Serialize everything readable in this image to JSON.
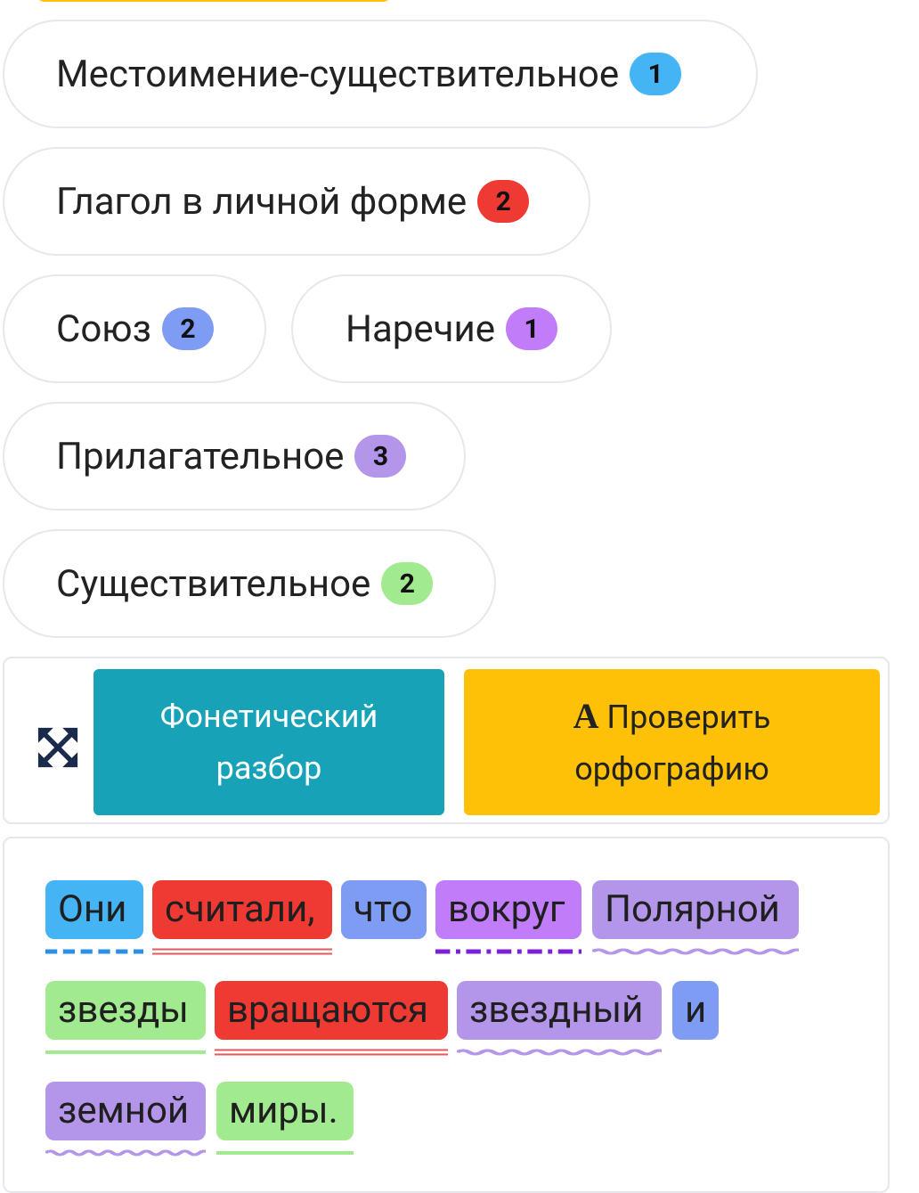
{
  "colors": {
    "pronoun": "#45b4f4",
    "verb": "#ef3a33",
    "conjunction": "#7f9cf5",
    "adverb": "#c07cf9",
    "adjective": "#b396ea",
    "noun": "#a1ea8f",
    "phonetic_button": "#17a2b8",
    "spell_button": "#ffc107"
  },
  "legend": [
    {
      "label": "Местоимение-существительное",
      "count": "1"
    },
    {
      "label": "Глагол в личной форме",
      "count": "2"
    },
    {
      "label": "Союз",
      "count": "2"
    },
    {
      "label": "Наречие",
      "count": "1"
    },
    {
      "label": "Прилагательное",
      "count": "3"
    },
    {
      "label": "Существительное",
      "count": "2"
    }
  ],
  "toolbar": {
    "expand_icon": "arrows-expand-icon",
    "phonetic_line1": "Фонетический",
    "phonetic_line2": "разбор",
    "spell_icon": "A",
    "spell_line1": "Проверить",
    "spell_line2": "орфографию"
  },
  "sentence": [
    {
      "text": "Они",
      "pos": "pronoun"
    },
    {
      "text": "считали,",
      "pos": "verb"
    },
    {
      "text": "что",
      "pos": "conjunction"
    },
    {
      "text": "вокруг",
      "pos": "adverb"
    },
    {
      "text": "Полярной",
      "pos": "adjective"
    },
    {
      "text": "звезды",
      "pos": "noun"
    },
    {
      "text": "вращаются",
      "pos": "verb"
    },
    {
      "text": "звездный",
      "pos": "adjective"
    },
    {
      "text": "и",
      "pos": "conjunction"
    },
    {
      "text": "земной",
      "pos": "adjective"
    },
    {
      "text": "миры.",
      "pos": "noun"
    }
  ]
}
